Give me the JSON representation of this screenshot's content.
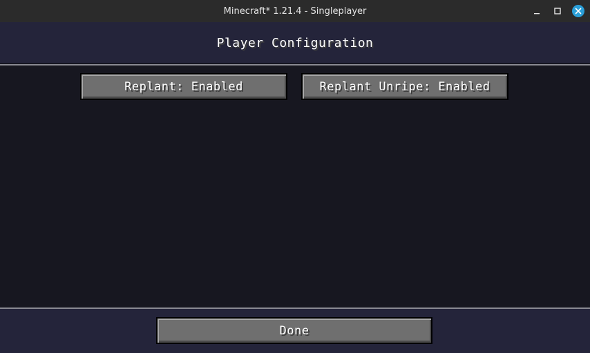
{
  "window": {
    "title": "Minecraft* 1.21.4 - Singleplayer",
    "controls": {
      "minimize_icon": "minimize-icon",
      "maximize_icon": "maximize-icon",
      "close_icon": "close-icon",
      "close_color": "#2a9fd8"
    }
  },
  "screen": {
    "title": "Player Configuration",
    "options": [
      {
        "label": "Replant: Enabled"
      },
      {
        "label": "Replant Unripe: Enabled"
      }
    ],
    "done_label": "Done"
  }
}
